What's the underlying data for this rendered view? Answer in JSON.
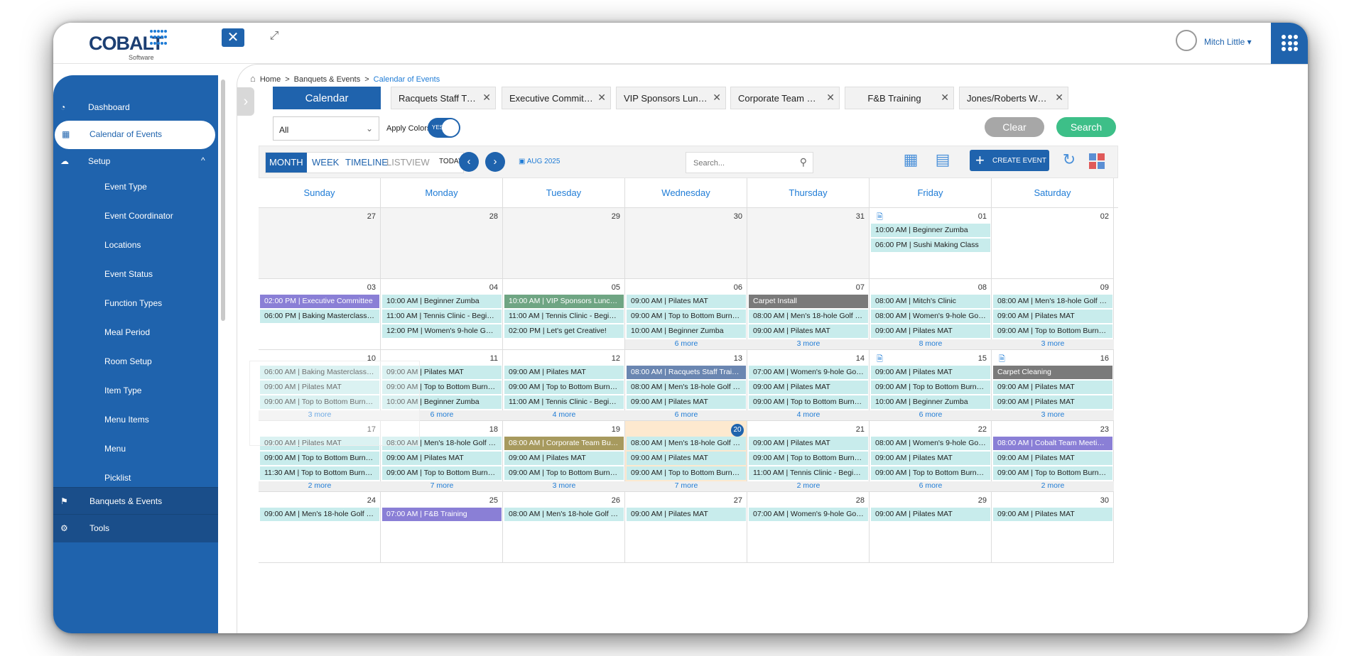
{
  "brand": {
    "name": "COBALT",
    "sub": "Software"
  },
  "user": {
    "name": "Mitch Little ▾"
  },
  "sidebar": {
    "items": [
      {
        "label": "Dashboard",
        "icon": "dashboard-icon"
      },
      {
        "label": "Calendar of Events",
        "icon": "calendar-icon"
      },
      {
        "label": "Setup",
        "icon": "setup-icon",
        "chevron": "^"
      },
      {
        "label": "Event Type"
      },
      {
        "label": "Event Coordinator"
      },
      {
        "label": "Locations"
      },
      {
        "label": "Event Status"
      },
      {
        "label": "Function Types"
      },
      {
        "label": "Meal Period"
      },
      {
        "label": "Room Setup"
      },
      {
        "label": "Item Type"
      },
      {
        "label": "Menu Items"
      },
      {
        "label": "Menu"
      },
      {
        "label": "Picklist"
      },
      {
        "label": "Banquets & Events",
        "icon": "banquets-icon"
      },
      {
        "label": "Tools",
        "icon": "tools-icon"
      }
    ]
  },
  "breadcrumb": {
    "home": "Home",
    "parent": "Banquets & Events",
    "current": "Calendar of Events",
    "sep": ">"
  },
  "tabs": [
    {
      "label": "Calendar"
    },
    {
      "label": "Racquets Staff Training"
    },
    {
      "label": "Executive Committee ..."
    },
    {
      "label": "VIP Sponsors Luncheon"
    },
    {
      "label": "Corporate Team Buildi..."
    },
    {
      "label": "F&B Training"
    },
    {
      "label": "Jones/Roberts Wedding"
    }
  ],
  "filter": {
    "value": "All"
  },
  "apply_colors": {
    "label": "Apply Colors",
    "toggle": "YES"
  },
  "buttons": {
    "clear": "Clear",
    "search": "Search",
    "create": "CREATE EVENT"
  },
  "views": {
    "month": "MONTH",
    "week": "WEEK",
    "timeline": "TIMELINE",
    "listview": "LISTVIEW"
  },
  "nav": {
    "today": "TODAY",
    "month_label": "AUG 2025"
  },
  "calendar_search": {
    "placeholder": "Search..."
  },
  "colors": {
    "primary": "#1f63ad",
    "search_green": "#3dbf88",
    "event_teal": "#c8ecec",
    "today_bg": "#fde9cf"
  },
  "days": [
    "Sunday",
    "Monday",
    "Tuesday",
    "Wednesday",
    "Thursday",
    "Friday",
    "Saturday"
  ],
  "weeks": [
    [
      {
        "day": "27",
        "prev": true,
        "events": [],
        "more": ""
      },
      {
        "day": "28",
        "prev": true,
        "events": [],
        "more": ""
      },
      {
        "day": "29",
        "prev": true,
        "events": [],
        "more": ""
      },
      {
        "day": "30",
        "prev": true,
        "events": [],
        "more": ""
      },
      {
        "day": "31",
        "prev": true,
        "events": [],
        "more": ""
      },
      {
        "day": "01",
        "doc": true,
        "events": [
          {
            "t": "10:00 AM | Beginner Zumba"
          },
          {
            "t": "06:00 PM | Sushi Making Class"
          }
        ],
        "more": ""
      },
      {
        "day": "02",
        "events": [],
        "more": ""
      }
    ],
    [
      {
        "day": "03",
        "events": [
          {
            "t": "02:00 PM | Executive Committee",
            "c": "purple"
          },
          {
            "t": "06:00 PM | Baking Masterclass S..."
          }
        ],
        "more": ""
      },
      {
        "day": "04",
        "events": [
          {
            "t": "10:00 AM | Beginner Zumba"
          },
          {
            "t": "11:00 AM | Tennis Clinic - Beginn..."
          },
          {
            "t": "12:00 PM | Women's 9-hole Golf ..."
          }
        ],
        "more": ""
      },
      {
        "day": "05",
        "events": [
          {
            "t": "10:00 AM | VIP Sponsors Luncheon",
            "c": "green"
          },
          {
            "t": "11:00 AM | Tennis Clinic - Beginn..."
          },
          {
            "t": "02:00 PM | Let's get Creative!"
          }
        ],
        "more": ""
      },
      {
        "day": "06",
        "events": [
          {
            "t": "09:00 AM | Pilates MAT"
          },
          {
            "t": "09:00 AM | Top to Bottom Burnout"
          },
          {
            "t": "10:00 AM | Beginner Zumba"
          }
        ],
        "more": "6 more"
      },
      {
        "day": "07",
        "events": [
          {
            "t": "Carpet Install",
            "c": "gray"
          },
          {
            "t": "08:00 AM | Men's 18-hole Golf To..."
          },
          {
            "t": "09:00 AM | Pilates MAT"
          }
        ],
        "more": "3 more"
      },
      {
        "day": "08",
        "events": [
          {
            "t": "08:00 AM | Mitch's Clinic"
          },
          {
            "t": "08:00 AM | Women's 9-hole Golf ..."
          },
          {
            "t": "09:00 AM | Pilates MAT"
          }
        ],
        "more": "8 more"
      },
      {
        "day": "09",
        "events": [
          {
            "t": "08:00 AM | Men's 18-hole Golf To..."
          },
          {
            "t": "09:00 AM | Pilates MAT"
          },
          {
            "t": "09:00 AM | Top to Bottom Burnout"
          }
        ],
        "more": "3 more"
      }
    ],
    [
      {
        "day": "10",
        "events": [
          {
            "t": "06:00 AM | Baking Masterclass S..."
          },
          {
            "t": "09:00 AM | Pilates MAT"
          },
          {
            "t": "09:00 AM | Top to Bottom Burnout"
          }
        ],
        "more": "3 more"
      },
      {
        "day": "11",
        "events": [
          {
            "t": "09:00 AM | Pilates MAT"
          },
          {
            "t": "09:00 AM | Top to Bottom Burnout"
          },
          {
            "t": "10:00 AM | Beginner Zumba"
          }
        ],
        "more": "6 more"
      },
      {
        "day": "12",
        "events": [
          {
            "t": "09:00 AM | Pilates MAT"
          },
          {
            "t": "09:00 AM | Top to Bottom Burnout"
          },
          {
            "t": "11:00 AM | Tennis Clinic - Beginn..."
          }
        ],
        "more": "4 more"
      },
      {
        "day": "13",
        "events": [
          {
            "t": "08:00 AM | Racquets Staff Training",
            "c": "slate"
          },
          {
            "t": "08:00 AM | Men's 18-hole Golf To..."
          },
          {
            "t": "09:00 AM | Pilates MAT"
          }
        ],
        "more": "6 more"
      },
      {
        "day": "14",
        "events": [
          {
            "t": "07:00 AM | Women's 9-hole Golf ..."
          },
          {
            "t": "09:00 AM | Pilates MAT"
          },
          {
            "t": "09:00 AM | Top to Bottom Burnout"
          }
        ],
        "more": "4 more"
      },
      {
        "day": "15",
        "doc": true,
        "events": [
          {
            "t": "09:00 AM | Pilates MAT"
          },
          {
            "t": "09:00 AM | Top to Bottom Burnout"
          },
          {
            "t": "10:00 AM | Beginner Zumba"
          }
        ],
        "more": "6 more"
      },
      {
        "day": "16",
        "doc": true,
        "events": [
          {
            "t": "Carpet Cleaning",
            "c": "gray"
          },
          {
            "t": "09:00 AM | Pilates MAT"
          },
          {
            "t": "09:00 AM | Pilates MAT"
          }
        ],
        "more": "3 more"
      }
    ],
    [
      {
        "day": "17",
        "events": [
          {
            "t": "09:00 AM | Pilates MAT"
          },
          {
            "t": "09:00 AM | Top to Bottom Burnout"
          },
          {
            "t": "11:30 AM | Top to Bottom Burnout"
          }
        ],
        "more": "2 more"
      },
      {
        "day": "18",
        "events": [
          {
            "t": "08:00 AM | Men's 18-hole Golf To..."
          },
          {
            "t": "09:00 AM | Pilates MAT"
          },
          {
            "t": "09:00 AM | Top to Bottom Burnout"
          }
        ],
        "more": "7 more"
      },
      {
        "day": "19",
        "events": [
          {
            "t": "08:00 AM | Corporate Team Building",
            "c": "olive"
          },
          {
            "t": "09:00 AM | Pilates MAT"
          },
          {
            "t": "09:00 AM | Top to Bottom Burnout"
          }
        ],
        "more": "3 more"
      },
      {
        "day": "20",
        "today": true,
        "events": [
          {
            "t": "08:00 AM | Men's 18-hole Golf To..."
          },
          {
            "t": "09:00 AM | Pilates MAT"
          },
          {
            "t": "09:00 AM | Top to Bottom Burnout"
          }
        ],
        "more": "7 more"
      },
      {
        "day": "21",
        "events": [
          {
            "t": "09:00 AM | Pilates MAT"
          },
          {
            "t": "09:00 AM | Top to Bottom Burnout"
          },
          {
            "t": "11:00 AM | Tennis Clinic - Beginn..."
          }
        ],
        "more": "2 more"
      },
      {
        "day": "22",
        "events": [
          {
            "t": "08:00 AM | Women's 9-hole Golf ..."
          },
          {
            "t": "09:00 AM | Pilates MAT"
          },
          {
            "t": "09:00 AM | Top to Bottom Burnout"
          }
        ],
        "more": "6 more"
      },
      {
        "day": "23",
        "events": [
          {
            "t": "08:00 AM | Cobalt Team Meetings -",
            "c": "purple"
          },
          {
            "t": "09:00 AM | Pilates MAT"
          },
          {
            "t": "09:00 AM | Top to Bottom Burnout"
          }
        ],
        "more": "2 more"
      }
    ],
    [
      {
        "day": "24",
        "events": [
          {
            "t": "09:00 AM | Men's 18-hole Golf To..."
          }
        ],
        "more": ""
      },
      {
        "day": "25",
        "events": [
          {
            "t": "07:00 AM | F&B Training",
            "c": "purple"
          }
        ],
        "more": ""
      },
      {
        "day": "26",
        "events": [
          {
            "t": "08:00 AM | Men's 18-hole Golf To..."
          }
        ],
        "more": ""
      },
      {
        "day": "27",
        "events": [
          {
            "t": "09:00 AM | Pilates MAT"
          }
        ],
        "more": ""
      },
      {
        "day": "28",
        "events": [
          {
            "t": "07:00 AM | Women's 9-hole Golf ..."
          }
        ],
        "more": ""
      },
      {
        "day": "29",
        "events": [
          {
            "t": "09:00 AM | Pilates MAT"
          }
        ],
        "more": ""
      },
      {
        "day": "30",
        "events": [
          {
            "t": "09:00 AM | Pilates MAT"
          }
        ],
        "more": ""
      }
    ]
  ]
}
